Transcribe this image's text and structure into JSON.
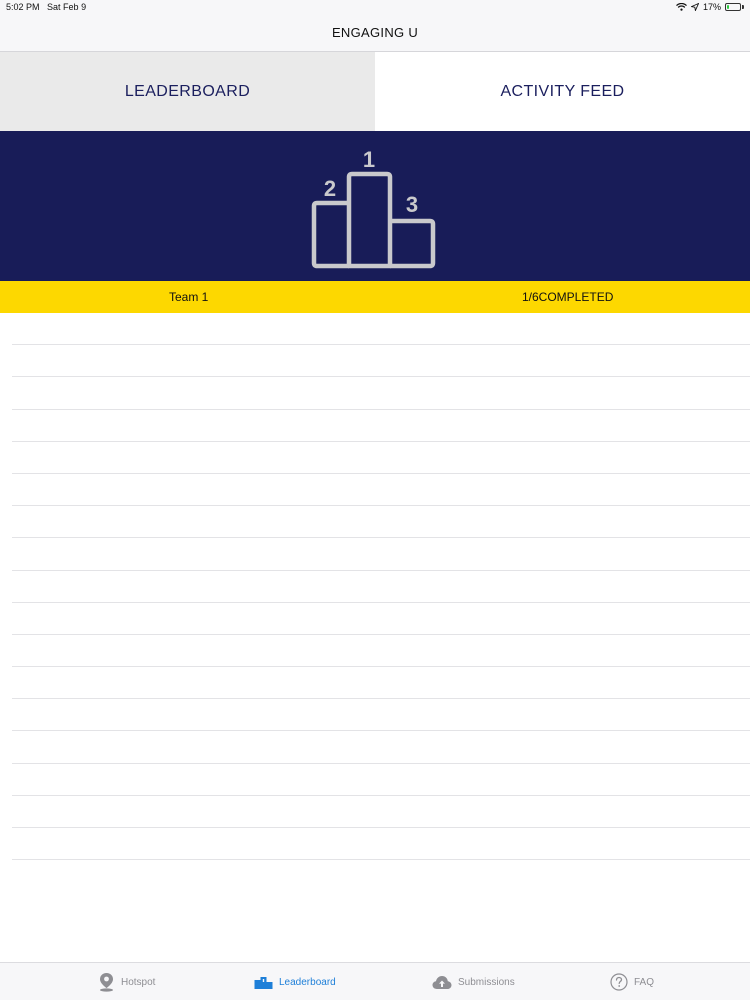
{
  "status": {
    "time": "5:02 PM",
    "date": "Sat Feb 9",
    "battery_percent": "17%",
    "battery_level": 0.17
  },
  "nav": {
    "title": "ENGAGING U"
  },
  "tabs": [
    {
      "label": "LEADERBOARD"
    },
    {
      "label": "ACTIVITY FEED"
    }
  ],
  "podium": {
    "first": "1",
    "second": "2",
    "third": "3",
    "icon": "podium-icon"
  },
  "team": {
    "name": "Team 1",
    "progress": "1/6COMPLETED"
  },
  "colors": {
    "banner": "#181c58",
    "team_bar": "#fdd800",
    "tab_text": "#1b1f5e",
    "active_tab": "#1e7fd8",
    "inactive_tab": "#8e8e93"
  },
  "tabbar": {
    "items": [
      {
        "label": "Hotspot",
        "icon": "map-pin-icon"
      },
      {
        "label": "Leaderboard",
        "icon": "podium-icon"
      },
      {
        "label": "Submissions",
        "icon": "cloud-upload-icon"
      },
      {
        "label": "FAQ",
        "icon": "question-circle-icon"
      }
    ]
  }
}
